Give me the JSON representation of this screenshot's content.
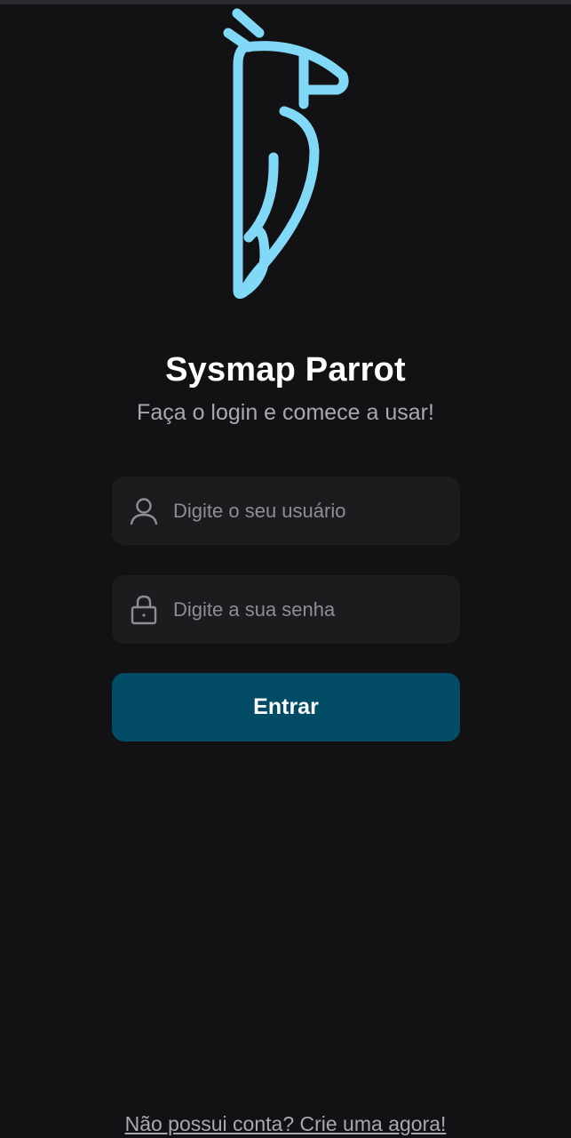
{
  "app": {
    "title": "Sysmap Parrot",
    "subtitle": "Faça o login e comece a usar!"
  },
  "login_form": {
    "username_placeholder": "Digite o seu usuário",
    "password_placeholder": "Digite a sua senha",
    "submit_label": "Entrar"
  },
  "footer": {
    "signup_link": "Não possui conta? Crie uma agora!"
  },
  "icons": {
    "logo": "parrot-logo",
    "username": "user-icon",
    "password": "lock-icon"
  },
  "colors": {
    "background": "#121214",
    "logo_accent": "#81d8f7",
    "field_background": "#1c1c1f",
    "button": "#034c66",
    "text_muted": "#a8a8b3"
  }
}
